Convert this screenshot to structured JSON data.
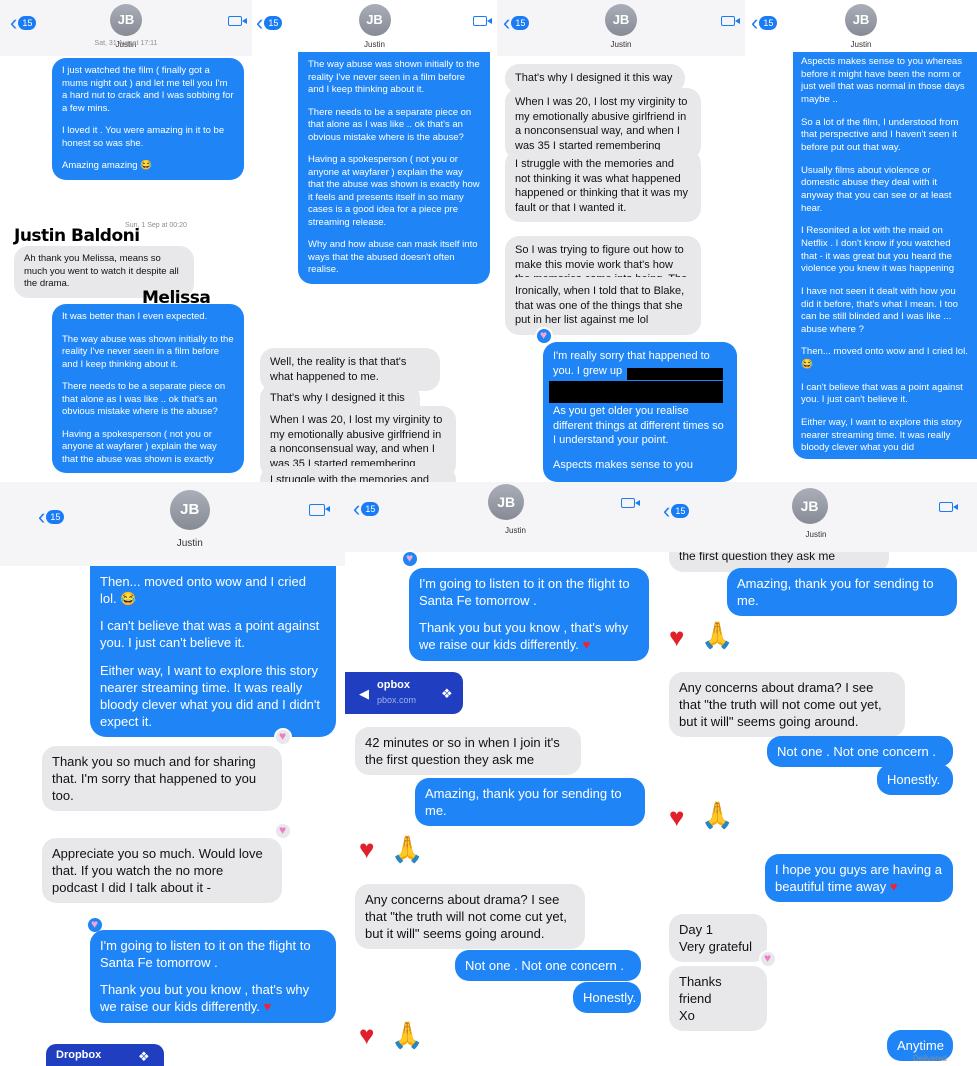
{
  "contact": {
    "initials": "JB",
    "name": "Justin",
    "badge": "15"
  },
  "icons": {
    "back": "chevron-left-icon",
    "video": "video-camera-icon",
    "heart": "red-heart-emoji",
    "pray": "folded-hands-emoji",
    "tapback": "heart-tapback-icon",
    "audio": "speaker-icon",
    "dropbox": "dropbox-icon"
  },
  "labels": {
    "justin": "Justin Baldoni",
    "melissa": "Melissa Nathan"
  },
  "colors": {
    "outgoing": "#1f85f7",
    "incoming": "#e8e8eb",
    "accent": "#1a7cf5",
    "dropbox": "#1f3ec0"
  },
  "p1": {
    "ts1": "Sat, 31 Aug at 17:11",
    "m1": [
      "I just watched the film ( finally got a mums night out ) and let me tell you I'm a hard nut to crack and I was sobbing for a few mins.",
      "I loved it . You were amazing in it to be honest so was she.",
      "Amazing amazing 😂"
    ],
    "ts2": "Sun, 1 Sep at 00:20",
    "m2": "Ah thank you Melissa, means so much you went to watch it despite all the drama.",
    "m3": [
      "It was better than I even expected.",
      "The way abuse was shown initially to the reality I've never seen in a film before and I keep thinking about it.",
      "There needs to be a separate piece on that alone as I was like .. ok that's an obvious mistake where is the abuse?",
      "Having a spokesperson ( not you or anyone at wayfarer ) explain the way that the abuse was shown is exactly"
    ]
  },
  "p2": {
    "m1": [
      "The way abuse was shown initially to the reality I've never seen in a film before and I keep thinking about it.",
      "There needs to be a separate piece on that alone as I was like .. ok that's an obvious mistake where is the abuse?",
      "Having a spokesperson ( not you or anyone at wayfarer ) explain the way that the abuse was shown is exactly how it feels and presents itself in so many cases is a good idea for a piece pre streaming release.",
      "Why and how abuse can mask itself into ways that the abused doesn't often realise."
    ],
    "m2": "Well, the reality is that that's what happened to me.",
    "m3": "That's why I designed it this way",
    "m4": "When I was 20, I lost my virginity to my emotionally abusive girlfriend in a nonconsensual way, and when I was 35 I started remembering",
    "m5": "I struggle with the memories and"
  },
  "p3": {
    "m1": "That's why I designed it this way",
    "m2": "When I was 20, I lost my virginity to my emotionally abusive girlfriend in a nonconsensual way, and when I was 35 I started remembering",
    "m3": "I struggle with the memories and not thinking it was what happened happened or thinking that it was my fault or that I wanted it.",
    "m4": "So I was trying to figure out how to make this movie work that's how the memories came into being. The book did not have any of that.",
    "m5": "Ironically, when I told that to Blake, that was one of the things that she put in her list against me lol",
    "m6a": "I'm really sorry that happened to you. I grew up",
    "m6b": "As you get older you realise different things at different times so I understand your point.",
    "m6c": "Aspects makes sense to you"
  },
  "p4": {
    "m1": [
      "Aspects makes sense to you whereas before it might have been the norm or just well that was normal in those days maybe ..",
      "So a lot of the film, I understood from that perspective and I haven't seen it before put out that way.",
      "Usually films about violence or domestic abuse they deal with it anyway that you can see or at least hear.",
      "I Resonited a lot with the maid on Netflix . I don't know if you watched that - it was great but you heard the violence you knew it was happening",
      "I have not seen it dealt with how you did it before, that's what I mean. I too can be still blinded and I was like ... abuse where ?",
      "Then... moved onto wow and I cried lol. 😂",
      "I can't believe that was a point against you. I just can't believe it.",
      "Either way, I want to explore this story nearer streaming time. It was really bloody clever what you did"
    ]
  },
  "p5": {
    "m1": [
      "Then... moved onto wow and I cried lol. 😂",
      "I can't believe that was a point against you. I just can't believe it.",
      "Either way, I want to explore this story nearer streaming time. It was really bloody clever what you did and I didn't expect it."
    ],
    "m2": "Thank you so much and for sharing that. I'm sorry that happened to you too.",
    "m3": "Appreciate you so much. Would love that. If you watch the no more podcast I did I talk about it -",
    "m4": [
      "I'm going to listen to it on the flight to Santa Fe tomorrow .",
      "Thank you but you know , that's why we raise our kids differently."
    ],
    "dropbox": "Dropbox"
  },
  "p6": {
    "m1": [
      "I'm going to listen to it on the flight to Santa Fe tomorrow .",
      "Thank you but you know , that's why we raise our kids differently."
    ],
    "dropbox_title": "opbox",
    "dropbox_url": "pbox.com",
    "m2": "42 minutes or so in when I join it's the first question they ask me",
    "m3": "Amazing, thank you for sending to me.",
    "m4": "Any concerns about drama? I see that \"the truth will not come cut yet, but it will\" seems  going around.",
    "m5": "Not one . Not one concern .",
    "m6": "Honestly."
  },
  "p7": {
    "m0": "the first question they ask me",
    "m1": "Amazing, thank you for sending to me.",
    "m2": "Any concerns about drama? I see that \"the truth will not come out yet, but it will\" seems  going around.",
    "m3": "Not one . Not one concern .",
    "m4": "Honestly.",
    "m5": "I hope you guys are having a beautiful time away",
    "m6": "Day 1\nVery grateful",
    "m7": "Thanks friend\nXo",
    "m8": "Anytime",
    "delivered": "Delivered"
  }
}
